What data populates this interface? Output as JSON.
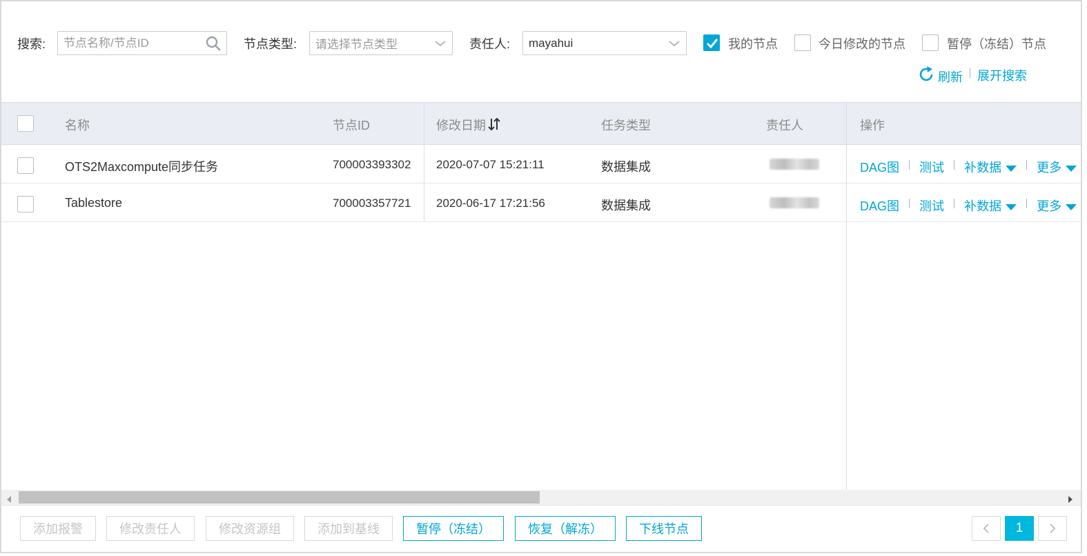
{
  "filters": {
    "search_label": "搜索:",
    "search_placeholder": "节点名称/节点ID",
    "node_type_label": "节点类型:",
    "node_type_placeholder": "请选择节点类型",
    "owner_label": "责任人:",
    "owner_value": "mayahui",
    "my_nodes_label": "我的节点",
    "my_nodes_checked": true,
    "modified_today_label": "今日修改的节点",
    "modified_today_checked": false,
    "paused_label": "暂停（冻结）节点",
    "paused_checked": false,
    "refresh_label": "刷新",
    "expand_search_label": "展开搜索"
  },
  "table": {
    "headers": {
      "name": "名称",
      "node_id": "节点ID",
      "modified": "修改日期",
      "task_type": "任务类型",
      "owner": "责任人",
      "actions": "操作"
    },
    "rows": [
      {
        "name": "OTS2Maxcompute同步任务",
        "node_id": "700003393302",
        "modified": "2020-07-07 15:21:11",
        "task_type": "数据集成"
      },
      {
        "name": "Tablestore",
        "node_id": "700003357721",
        "modified": "2020-06-17 17:21:56",
        "task_type": "数据集成"
      }
    ],
    "actions": {
      "dag": "DAG图",
      "test": "测试",
      "backfill": "补数据",
      "more": "更多"
    }
  },
  "footer": {
    "add_alert": "添加报警",
    "change_owner": "修改责任人",
    "change_resource_group": "修改资源组",
    "add_baseline": "添加到基线",
    "pause": "暂停（冻结）",
    "resume": "恢复（解冻）",
    "offline": "下线节点",
    "current_page": "1"
  },
  "colors": {
    "accent": "#00a6d6",
    "header_bg": "#eaedf4",
    "disabled_text": "#c5c5c5"
  }
}
